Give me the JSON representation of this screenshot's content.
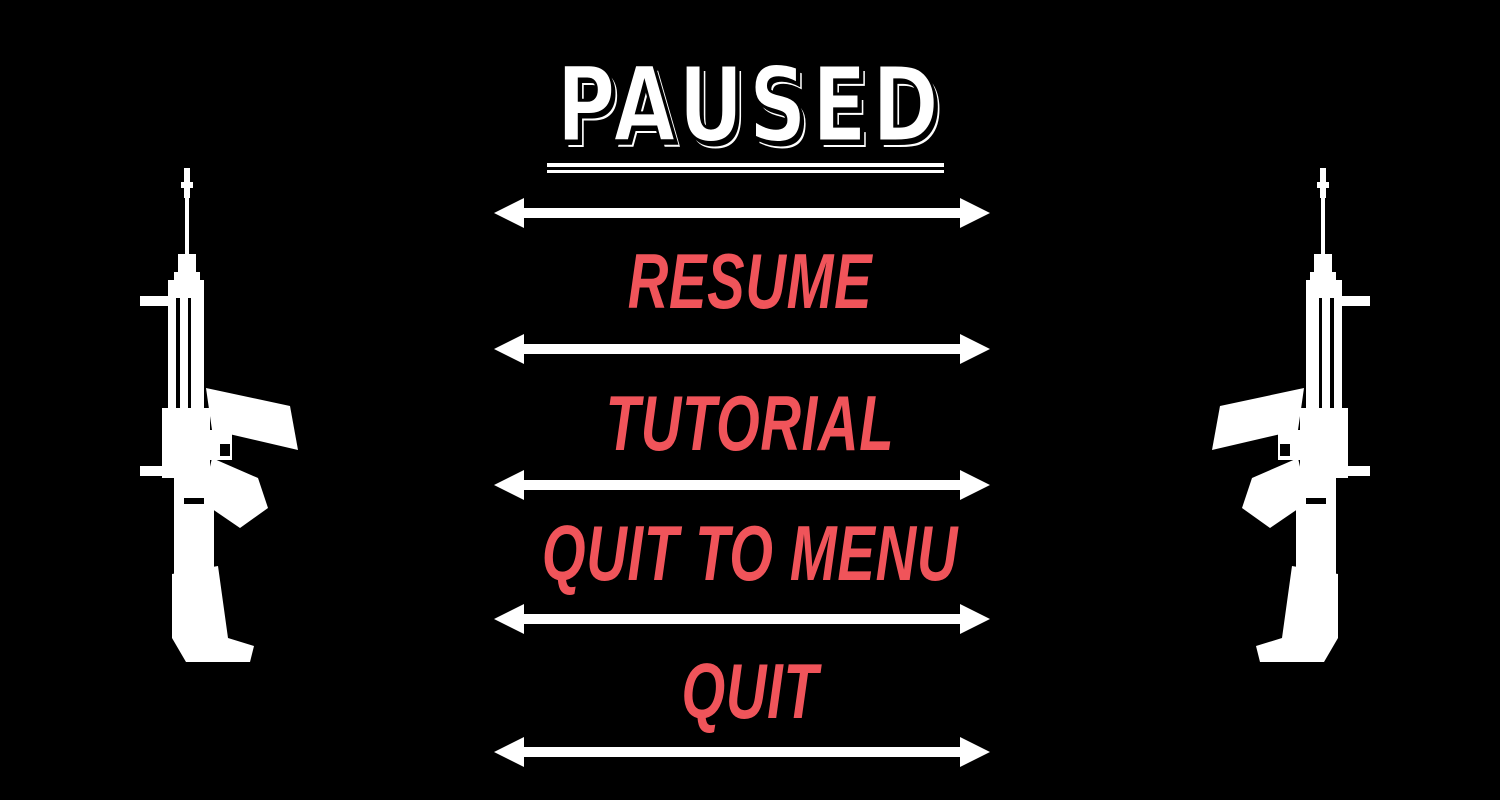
{
  "pause_menu": {
    "title": "PAUSED",
    "items": [
      {
        "label": "RESUME"
      },
      {
        "label": "TUTORIAL"
      },
      {
        "label": "QUIT TO MENU"
      },
      {
        "label": "QUIT"
      }
    ]
  },
  "decorations": {
    "left_icon": "rifle-icon",
    "right_icon": "rifle-icon",
    "divider_icon": "double-arrow-icon"
  },
  "colors": {
    "background": "#000000",
    "menu_text": "#f0545a",
    "title_text": "#ffffff",
    "divider": "#ffffff"
  }
}
